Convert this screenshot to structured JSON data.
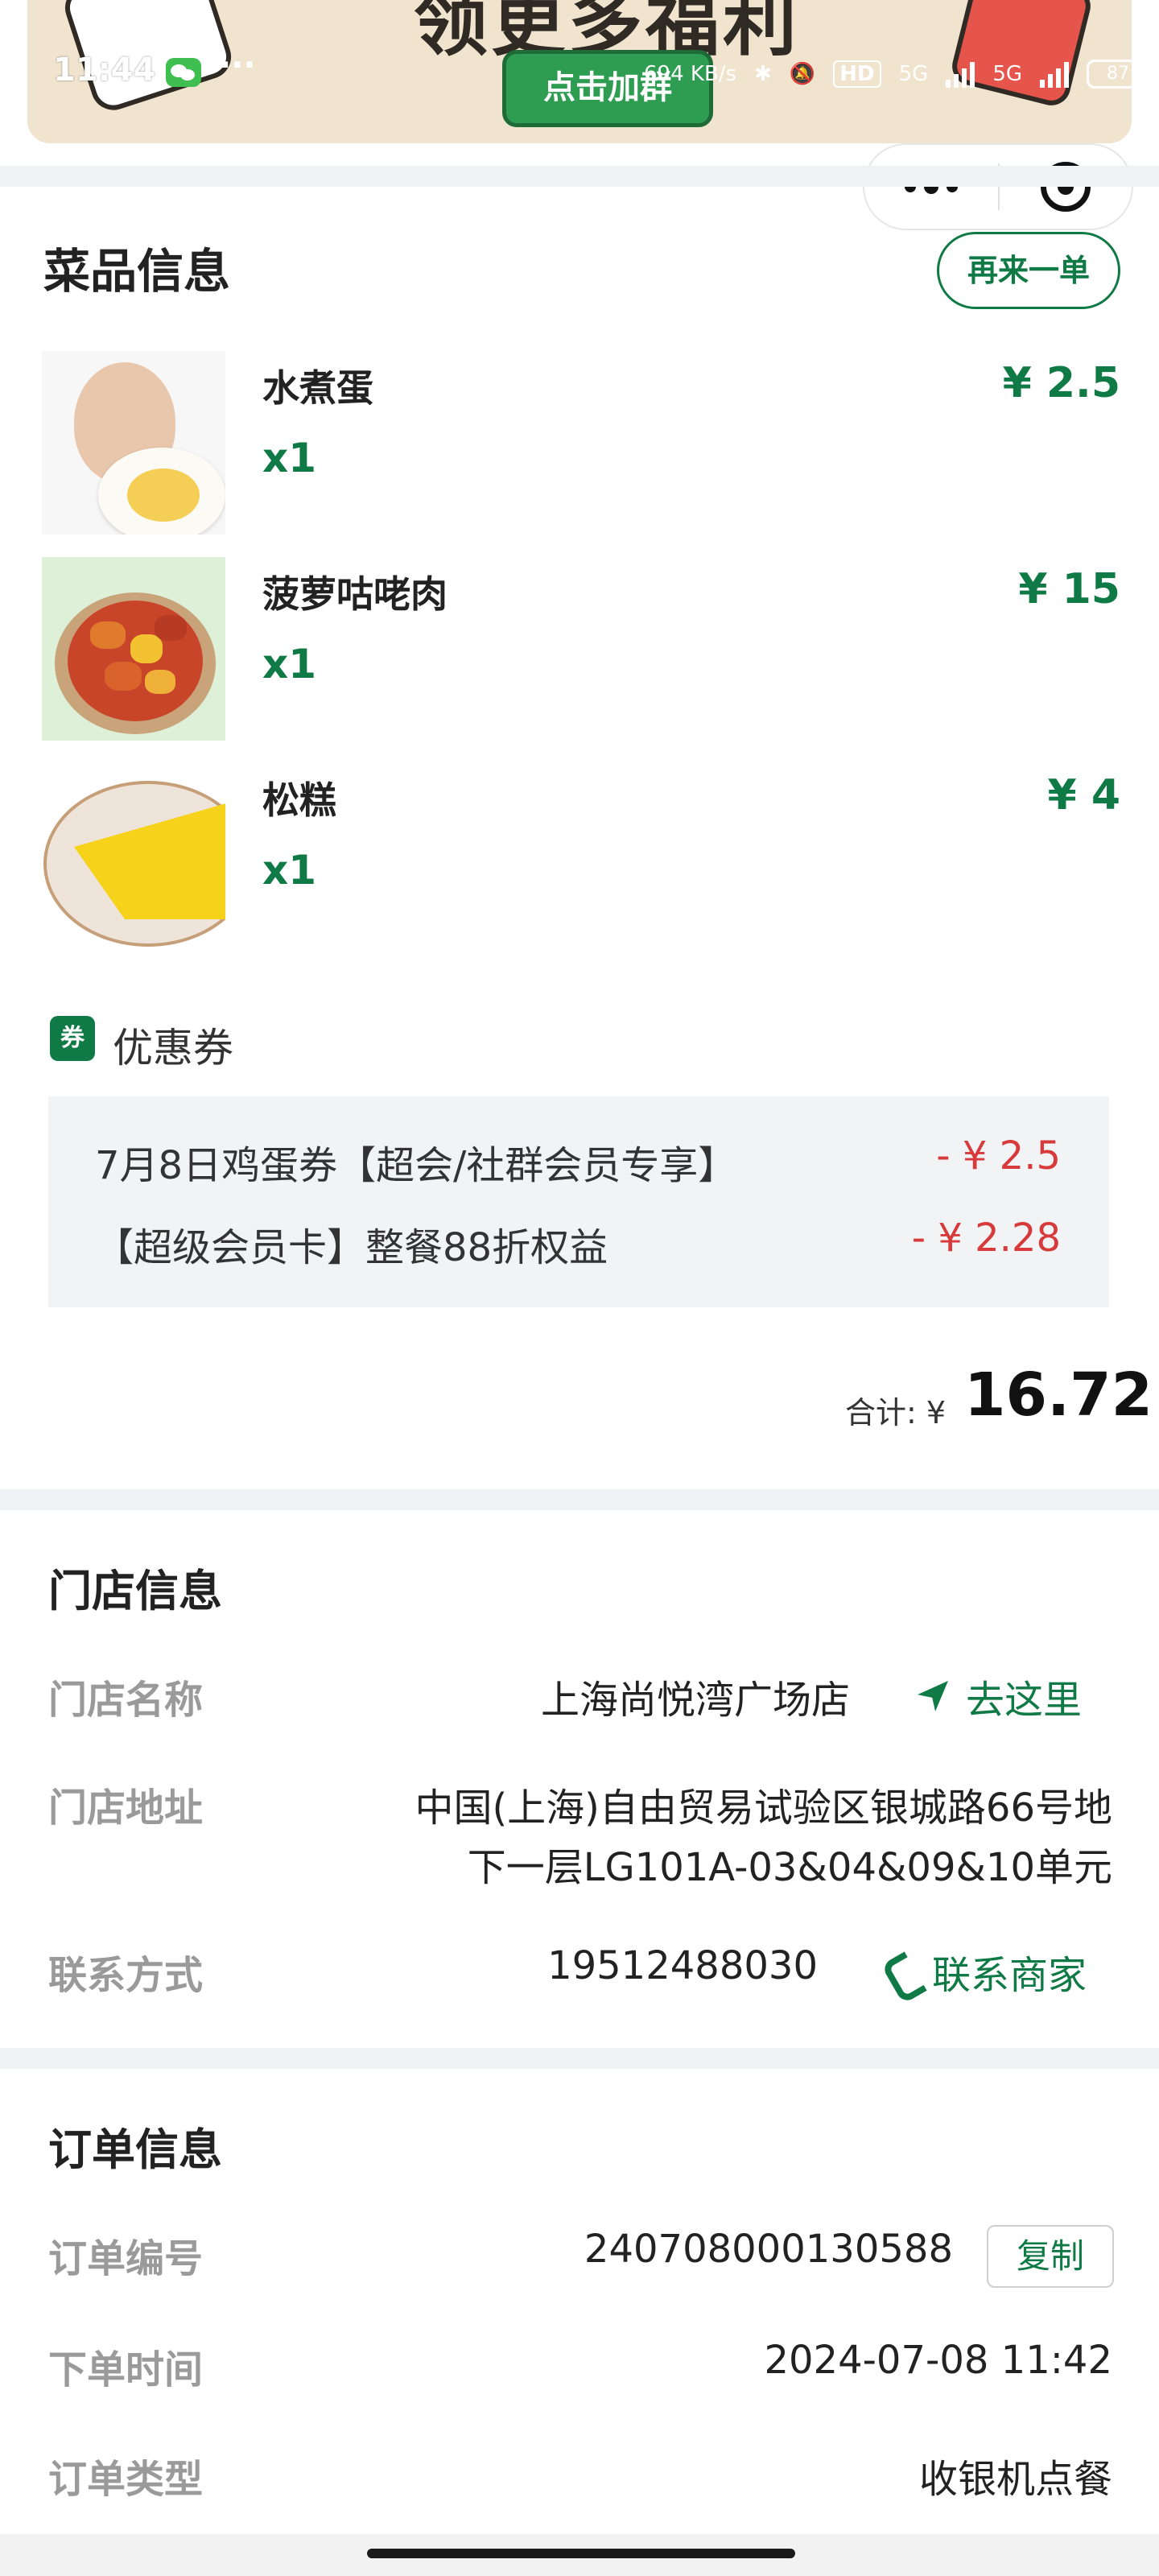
{
  "status_bar": {
    "time": "11:44",
    "more": "···",
    "net_speed": "694 KB/s",
    "hd_label": "HD",
    "sig1": "5G",
    "sig2": "5G",
    "battery": "87"
  },
  "banner": {
    "title": "领更多福利",
    "cta": "点击加群"
  },
  "dishes": {
    "title": "菜品信息",
    "reorder_button": "再来一单",
    "items": [
      {
        "name": "水煮蛋",
        "qty": "x1",
        "price": "¥ 2.5"
      },
      {
        "name": "菠萝咕咾肉",
        "qty": "x1",
        "price": "¥ 15"
      },
      {
        "name": "松糕",
        "qty": "x1",
        "price": "¥ 4"
      }
    ]
  },
  "coupons": {
    "badge": "券",
    "title": "优惠券",
    "items": [
      {
        "name": "7月8日鸡蛋券【超会/社群会员专享】",
        "amount": "- ¥ 2.5"
      },
      {
        "name": "【超级会员卡】整餐88折权益",
        "amount": "- ¥ 2.28"
      }
    ]
  },
  "total": {
    "label": "合计: ¥",
    "value": "16.72"
  },
  "store": {
    "title": "门店信息",
    "name_label": "门店名称",
    "name": "上海尚悦湾广场店",
    "goto": "去这里",
    "address_label": "门店地址",
    "address_line1": "中国(上海)自由贸易试验区银城路66号地",
    "address_line2": "下一层LG101A-03&04&09&10单元",
    "contact_label": "联系方式",
    "phone": "19512488030",
    "contact_merchant": "联系商家"
  },
  "order": {
    "title": "订单信息",
    "number_label": "订单编号",
    "number": "240708000130588",
    "copy": "复制",
    "time_label": "下单时间",
    "time": "2024-07-08 11:42",
    "type_label": "订单类型",
    "type": "收银机点餐"
  },
  "colors": {
    "accent_green": "#0f7a45",
    "discount_red": "#d63a3a",
    "divider_gray": "#eff2f4"
  }
}
